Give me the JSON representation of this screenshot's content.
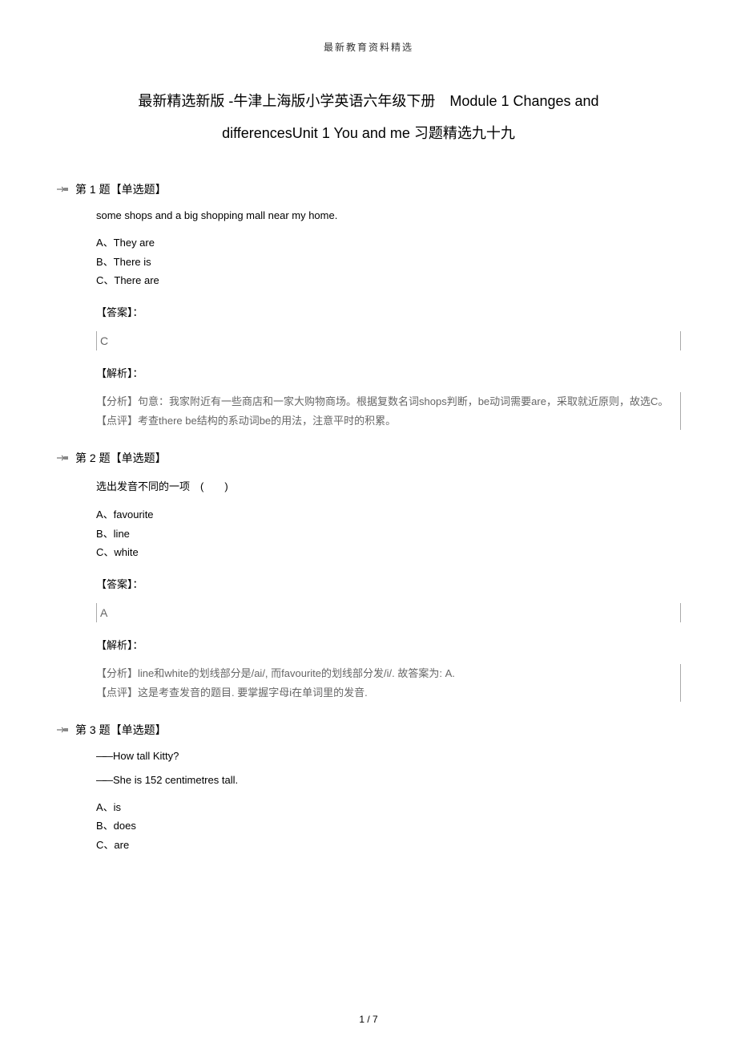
{
  "header_note": "最新教育资料精选",
  "title": "最新精选新版 -牛津上海版小学英语六年级下册　Module 1 Changes and differencesUnit 1 You and me 习题精选九十九",
  "questions": [
    {
      "header": "第 1 题【单选题】",
      "stem": "some shops and a big shopping mall near my home.",
      "options": {
        "a": "A、They are",
        "b": "B、There is",
        "c": "C、There are"
      },
      "answer_label": "【答案】：",
      "answer": "C",
      "analysis_label": "【解析】：",
      "analysis_line1": "【分析】句意：我家附近有一些商店和一家大购物商场。根据复数名词shops判断，be动词需要are，采取就近原则，故选C。",
      "analysis_line2": "【点评】考查there be结构的系动词be的用法，注意平时的积累。"
    },
    {
      "header": "第 2 题【单选题】",
      "stem": "选出发音不同的一项　(　　)",
      "options": {
        "a": "A、favourite",
        "b": "B、line",
        "c": "C、white"
      },
      "answer_label": "【答案】：",
      "answer": "A",
      "analysis_label": "【解析】：",
      "analysis_line1": "【分析】line和white的划线部分是/ai/, 而favourite的划线部分发/i/. 故答案为: A.",
      "analysis_line2": "【点评】这是考查发音的题目. 要掌握字母i在单词里的发音."
    },
    {
      "header": "第 3 题【单选题】",
      "stem1": "—How tall Kitty?",
      "stem2": "—She is 152 centimetres tall.",
      "options": {
        "a": "A、is",
        "b": "B、does",
        "c": "C、are"
      }
    }
  ],
  "footer": "1 / 7"
}
